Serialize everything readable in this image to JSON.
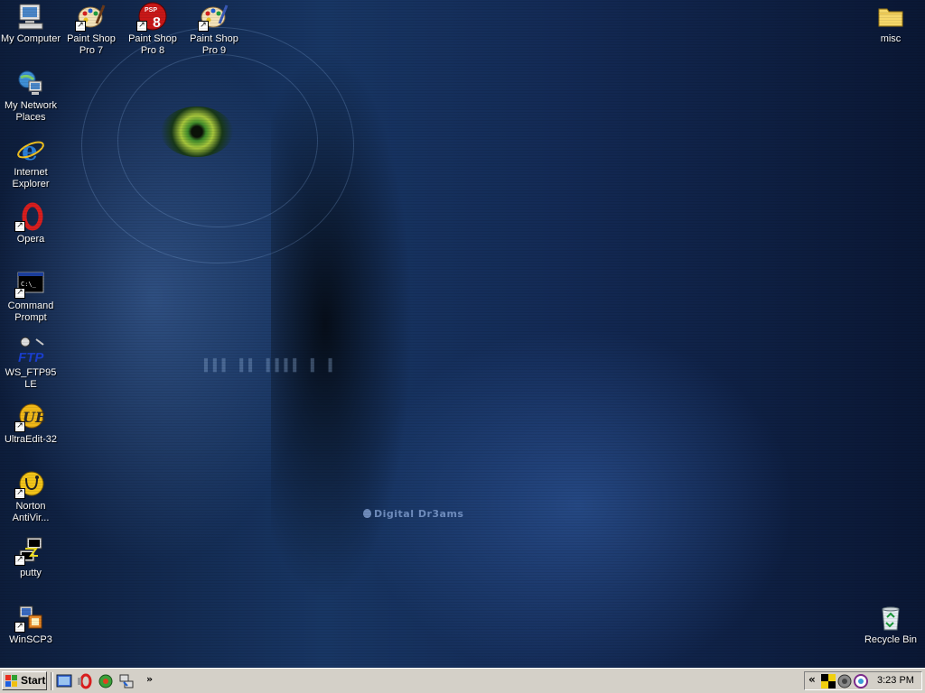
{
  "desktop": {
    "watermark": "Digital Dr3ams",
    "icons": [
      {
        "label": "My Computer",
        "icon": "computer-icon"
      },
      {
        "label": "My Network Places",
        "icon": "network-places-icon"
      },
      {
        "label": "Internet Explorer",
        "icon": "internet-explorer-icon"
      },
      {
        "label": "Opera",
        "icon": "opera-icon"
      },
      {
        "label": "Command Prompt",
        "icon": "command-prompt-icon"
      },
      {
        "label": "WS_FTP95 LE",
        "icon": "ftp-icon"
      },
      {
        "label": "UltraEdit-32",
        "icon": "ultraedit-icon"
      },
      {
        "label": "Norton AntiVir...",
        "icon": "norton-antivirus-icon"
      },
      {
        "label": "putty",
        "icon": "putty-icon"
      },
      {
        "label": "WinSCP3",
        "icon": "winscp-icon"
      },
      {
        "label": "Paint Shop Pro 7",
        "icon": "paint-shop-pro-icon"
      },
      {
        "label": "Paint Shop Pro 8",
        "icon": "paint-shop-pro-8-icon",
        "badge": "PSP",
        "badge_num": "8"
      },
      {
        "label": "Paint Shop Pro 9",
        "icon": "paint-shop-pro-icon"
      },
      {
        "label": "misc",
        "icon": "folder-icon"
      },
      {
        "label": "Recycle Bin",
        "icon": "recycle-bin-icon"
      }
    ]
  },
  "taskbar": {
    "start_label": "Start",
    "quicklaunch_more": "»",
    "tray_expand": "«",
    "clock": "3:23 PM"
  },
  "colors": {
    "taskbar": "#d4d0c8",
    "desktop_text": "#ffffff",
    "desktop_bg": "#132a55"
  }
}
